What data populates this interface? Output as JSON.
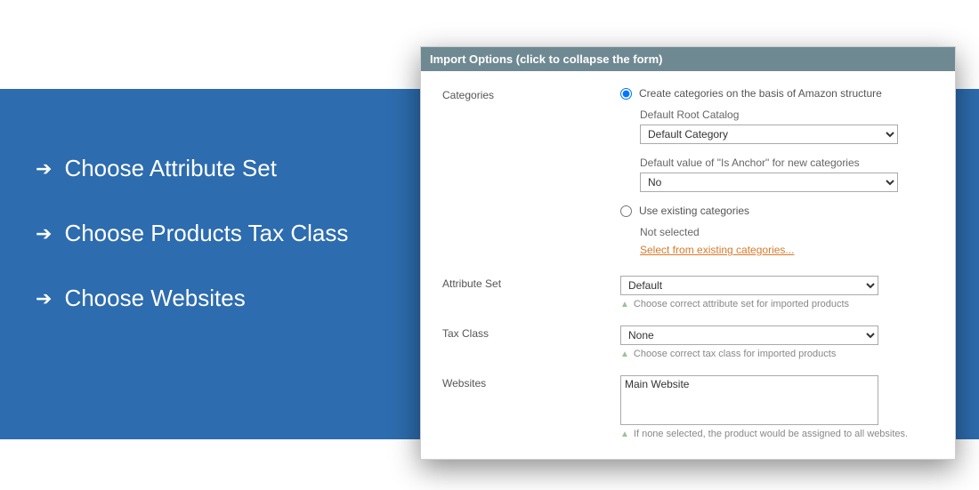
{
  "bullets": {
    "items": [
      "Choose Attribute Set",
      "Choose Products Tax Class",
      "Choose Websites"
    ]
  },
  "panel": {
    "header": "Import Options (click to collapse the form)",
    "categories": {
      "label": "Categories",
      "createOption": "Create categories on the basis of Amazon structure",
      "existingOption": "Use existing categories",
      "rootLabel": "Default Root Catalog",
      "rootValue": "Default Category",
      "anchorLabel": "Default value of \"Is Anchor\" for new categories",
      "anchorValue": "No",
      "notSelected": "Not selected",
      "selectLink": "Select from existing categories..."
    },
    "attributeSet": {
      "label": "Attribute Set",
      "value": "Default",
      "hint": "Choose correct attribute set for imported products"
    },
    "taxClass": {
      "label": "Tax Class",
      "value": "None",
      "hint": "Choose correct tax class for imported products"
    },
    "websites": {
      "label": "Websites",
      "value": "Main Website",
      "hint": "If none selected, the product would be assigned to all websites."
    }
  }
}
